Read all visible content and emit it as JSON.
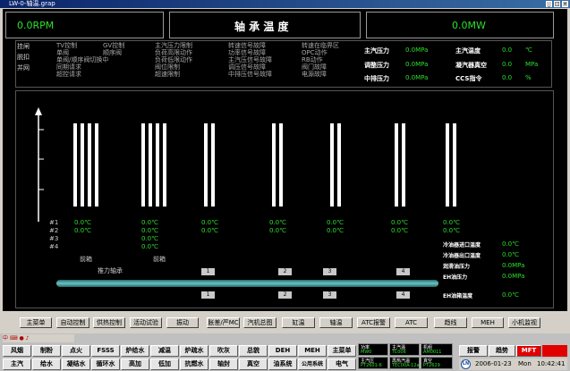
{
  "window": {
    "title": "LW-0-轴温.grap"
  },
  "header": {
    "rpm": "0.0RPM",
    "title": "轴 承 温 度",
    "power": "0.0MW"
  },
  "status_left": {
    "group": [
      "挂闸",
      "脱扣",
      "并网"
    ],
    "col1": [
      "TV控制",
      "单阀",
      "单阀/顺序阀切换中",
      "同期请求",
      "超控请求"
    ],
    "col2": [
      "GV控制",
      "顺序阀"
    ],
    "col3": [
      "主汽压力限制",
      "负荷高限动作",
      "负荷低限动作",
      "阀位限制",
      "超速限制"
    ],
    "col4": [
      "转速信号故障",
      "功率信号故障",
      "主汽压信号故障",
      "调压信号故障",
      "中排压信号故障"
    ],
    "col5": [
      "转速在临界区",
      "OPC动作",
      "RB动作",
      "阀门故障",
      "电源故障"
    ]
  },
  "status_right": {
    "rows": [
      {
        "label1": "主汽压力",
        "value1": "0.0MPa",
        "label2": "主汽温度",
        "value2": "0.0",
        "unit2": "℃"
      },
      {
        "label1": "调整压力",
        "value1": "0.0MPa",
        "label2": "凝汽器真空",
        "value2": "0.0",
        "unit2": "MPa"
      },
      {
        "label1": "中排压力",
        "value1": "0.0MPa",
        "label2": "CCS指令",
        "value2": "0.0",
        "unit2": "%"
      }
    ]
  },
  "chart": {
    "row_labels": [
      "#1",
      "#2",
      "#3",
      "#4"
    ],
    "groups": [
      {
        "r1": "0.0℃",
        "r2": "0.0℃",
        "r3": "",
        "r4": "",
        "caption": "前箱"
      },
      {
        "r1": "0.0℃",
        "r2": "0.0℃",
        "r3": "0.0℃",
        "r4": "0.0℃",
        "caption": "前箱"
      },
      {
        "r1": "0.0℃",
        "r2": "0.0℃",
        "r3": "",
        "r4": "",
        "caption": ""
      },
      {
        "r1": "0.0℃",
        "r2": "0.0℃",
        "r3": "",
        "r4": "",
        "caption": ""
      },
      {
        "r1": "0.0℃",
        "r2": "0.0℃",
        "r3": "",
        "r4": "",
        "caption": ""
      },
      {
        "r1": "0.0℃",
        "r2": "0.0℃",
        "r3": "",
        "r4": "",
        "caption": ""
      },
      {
        "r1": "0.0℃",
        "r2": "0.0℃",
        "r3": "",
        "r4": "",
        "caption": ""
      }
    ],
    "thrust_label": "推力轴承",
    "bearing_numbers_top": [
      "1",
      "2",
      "3",
      "4"
    ],
    "bearing_numbers_bottom": [
      "1",
      "2",
      "3",
      "4"
    ]
  },
  "side_readings": [
    {
      "label": "冷油器进口温度",
      "value": "0.0℃"
    },
    {
      "label": "冷油器出口温度",
      "value": "0.0℃"
    },
    {
      "label": "润滑油压力",
      "value": "0.0MPa"
    },
    {
      "label": "EH油压力",
      "value": "0.0MPa"
    },
    {
      "label": "EH油箱温度",
      "value": "0.0℃"
    }
  ],
  "screen_buttons": [
    "主菜单",
    "自动控制",
    "供热控制",
    "活动试验",
    "振动",
    "胀差/严MC",
    "汽机总图",
    "缸温",
    "轴温",
    "ATC报警",
    "ATC",
    "趋线",
    "MEH",
    "小机监视"
  ],
  "taskbar": {
    "row1": [
      "风烟",
      "制粉",
      "点火",
      "FSSS",
      "炉给水",
      "减温",
      "炉疏水",
      "吹灰",
      "总貌",
      "DEH",
      "MEH",
      "主菜单"
    ],
    "row2": [
      "主汽",
      "给水",
      "凝结水",
      "循环水",
      "高加",
      "低加",
      "抗燃水",
      "轴封",
      "真空",
      "油系统",
      "公用系统",
      "电气"
    ],
    "minis": [
      {
        "a": "功率",
        "b": "MW0"
      },
      {
        "a": "主汽温",
        "b": "TC006"
      },
      {
        "a": "机组",
        "b": "AM0011"
      },
      {
        "a": "主汽压",
        "b": "PT2601-6"
      },
      {
        "a": "再热汽温",
        "b": "TEC00A-12a"
      },
      {
        "a": "真空",
        "b": "PT2629"
      }
    ],
    "alarm": "报警",
    "trend": "趋势",
    "mft": "MFT",
    "date": "2006-01-23",
    "day": "Mon",
    "time": "10:42:41"
  }
}
